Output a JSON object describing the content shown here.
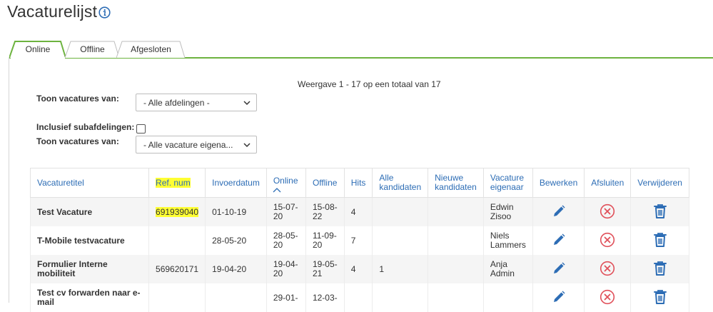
{
  "page": {
    "title": "Vacaturelijst"
  },
  "tabs": [
    {
      "label": "Online",
      "active": true
    },
    {
      "label": "Offline",
      "active": false
    },
    {
      "label": "Afgesloten",
      "active": false
    }
  ],
  "count_text": "Weergave 1 - 17 op een totaal van 17",
  "filters": {
    "dept_label": "Toon vacatures van:",
    "dept_value": "- Alle afdelingen -",
    "sub_label": "Inclusief subafdelingen:",
    "sub_checked": false,
    "owner_label": "Toon vacatures van:",
    "owner_value": "- Alle vacature eigena..."
  },
  "table": {
    "headers": {
      "title": "Vacaturetitel",
      "ref": "Ref. num",
      "invoer": "Invoerdatum",
      "online": "Online",
      "offline": "Offline",
      "hits": "Hits",
      "alle_1": "Alle",
      "alle_2": "kandidaten",
      "nieuwe_1": "Nieuwe",
      "nieuwe_2": "kandidaten",
      "eig_1": "Vacature",
      "eig_2": "eigenaar",
      "bewerken": "Bewerken",
      "afsluiten": "Afsluiten",
      "verwijderen": "Verwijderen"
    },
    "rows": [
      {
        "title": "Test Vacature",
        "ref": "691939040",
        "invoer": "01-10-19",
        "online_1": "15-07-",
        "online_2": "20",
        "offline_1": "15-08-",
        "offline_2": "22",
        "hits": "4",
        "alle": "",
        "nieuwe": "",
        "owner_1": "Edwin",
        "owner_2": "Zisoo"
      },
      {
        "title": "T-Mobile testvacature",
        "ref": "",
        "invoer": "28-05-20",
        "online_1": "28-05-",
        "online_2": "20",
        "offline_1": "11-09-",
        "offline_2": "20",
        "hits": "7",
        "alle": "",
        "nieuwe": "",
        "owner_1": "Niels",
        "owner_2": "Lammers"
      },
      {
        "title": "Formulier Interne mobiliteit",
        "ref": "569620171",
        "invoer": "19-04-20",
        "online_1": "19-04-",
        "online_2": "20",
        "offline_1": "19-05-",
        "offline_2": "21",
        "hits": "4",
        "alle": "1",
        "nieuwe": "",
        "owner_1": "Anja",
        "owner_2": "Admin"
      },
      {
        "title": "Test cv forwarden naar e-mail",
        "ref": "",
        "invoer": "",
        "online_1": "29-01-",
        "online_2": "",
        "offline_1": "12-03-",
        "offline_2": "",
        "hits": "",
        "alle": "",
        "nieuwe": "",
        "owner_1": "",
        "owner_2": ""
      }
    ]
  },
  "colors": {
    "accent_green": "#6db33f",
    "link_blue": "#2d6db5",
    "close_red": "#e0505a",
    "highlight": "#ffff33"
  }
}
